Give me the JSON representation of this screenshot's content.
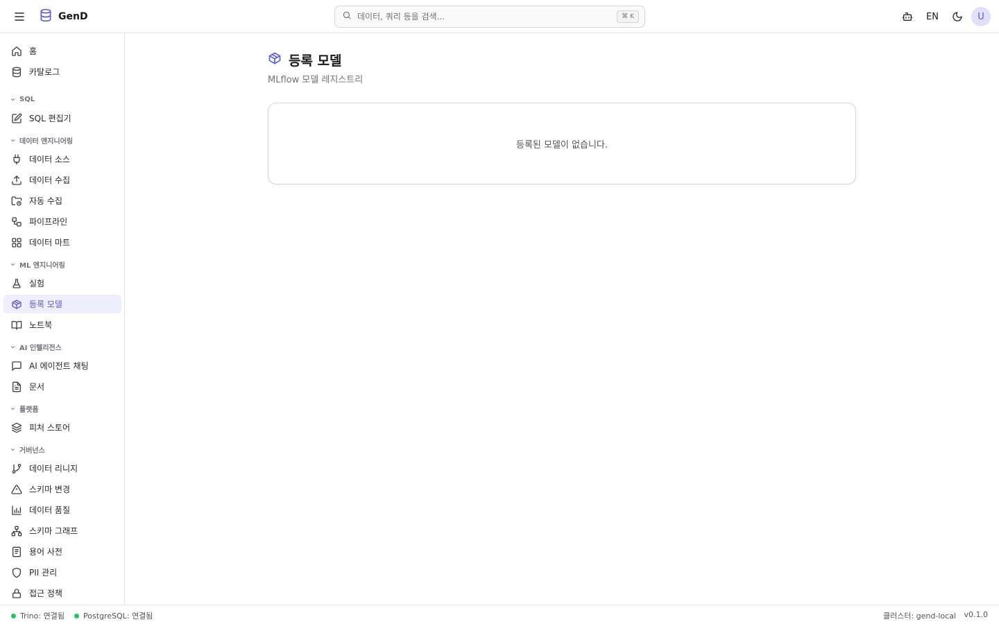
{
  "header": {
    "brand": "GenD",
    "search_placeholder": "데이터, 쿼리 등을 검색...",
    "search_shortcut": "⌘ K",
    "language": "EN",
    "avatar_initial": "U"
  },
  "sidebar": {
    "items": {
      "home": "홈",
      "catalog": "카탈로그",
      "sql_editor": "SQL 편집기",
      "data_sources": "데이터 소스",
      "data_ingestion": "데이터 수집",
      "auto_ingestion": "자동 수집",
      "pipelines": "파이프라인",
      "data_marts": "데이터 마트",
      "experiments": "실험",
      "registered_models": "등록 모델",
      "notebooks": "노트북",
      "ai_agent_chat": "AI 에이전트 채팅",
      "documents": "문서",
      "feature_store": "피처 스토어",
      "data_lineage": "데이터 리니지",
      "schema_changes": "스키마 변경",
      "data_quality": "데이터 품질",
      "schema_graph": "스키마 그래프",
      "glossary": "용어 사전",
      "pii_management": "PII 관리",
      "access_policies": "접근 정책"
    },
    "sections": {
      "sql": "SQL",
      "data_engineering": "데이터 엔지니어링",
      "ml_engineering": "ML 엔지니어링",
      "ai_intelligence": "AI 인텔리전스",
      "platform": "플랫폼",
      "governance": "거버넌스"
    },
    "active": "registered_models"
  },
  "main": {
    "title": "등록 모델",
    "subtitle": "MLflow 모델 레지스트리",
    "empty_message": "등록된 모델이 없습니다."
  },
  "statusbar": {
    "trino": "Trino: 연결됨",
    "postgres": "PostgreSQL: 연결됨",
    "cluster": "클러스터: gend-local",
    "version": "v0.1.0"
  },
  "colors": {
    "accent": "#5b5bd6",
    "active_bg": "#eeeefd",
    "connected": "#22c55e"
  }
}
